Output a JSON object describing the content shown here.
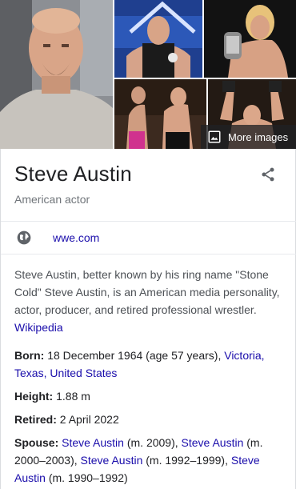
{
  "images": {
    "more_images_label": "More images"
  },
  "header": {
    "title": "Steve Austin",
    "subtitle": "American actor"
  },
  "website": {
    "label": "wwe.com"
  },
  "description": {
    "text": "Steve Austin, better known by his ring name \"Stone Cold\" Steve Austin, is an American media personality, actor, producer, and retired professional wrestler.",
    "source_link": "Wikipedia"
  },
  "facts": {
    "born": {
      "label": "Born:",
      "value": "18 December 1964 (age 57 years),",
      "place_1": "Victoria,",
      "place_2": "Texas,",
      "place_3": "United States"
    },
    "height": {
      "label": "Height:",
      "value": "1.88 m"
    },
    "retired": {
      "label": "Retired:",
      "value": "2 April 2022"
    },
    "spouse": {
      "label": "Spouse:",
      "entries": [
        {
          "name": "Steve Austin",
          "years": "(m. 2009),"
        },
        {
          "name": "Steve Austin",
          "years": "(m. 2000–2003),"
        },
        {
          "name": "Steve Austin",
          "years": "(m. 1992–1999),"
        },
        {
          "name": "Steve Austin",
          "years": "(m. 1990–1992)"
        }
      ]
    }
  },
  "colors": {
    "link": "#1a0dab",
    "text": "#202124",
    "muted": "#70757a",
    "divider": "#e8eaed"
  }
}
